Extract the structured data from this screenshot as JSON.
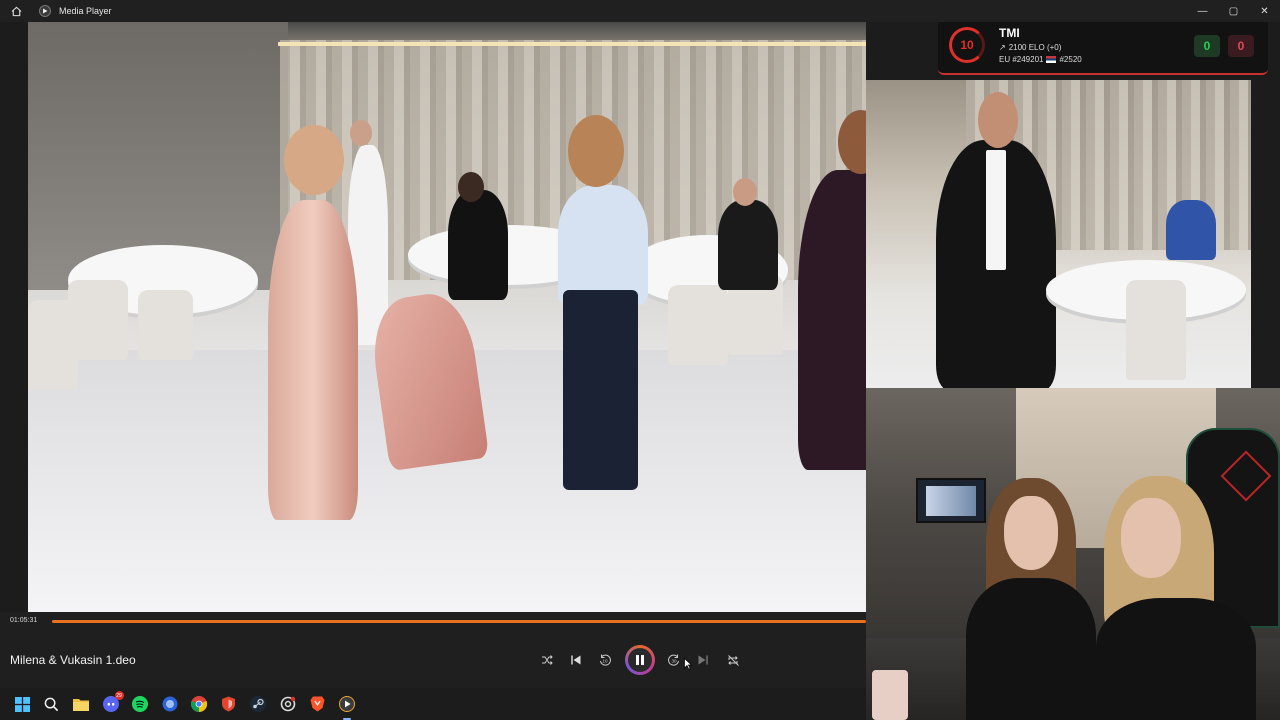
{
  "window": {
    "title": "Media Player",
    "controls": {
      "minimize": "—",
      "maximize": "▢",
      "close": "✕"
    }
  },
  "overlay": {
    "level": "10",
    "player_name": "TMI",
    "elo_line": "2100 ELO (+0)",
    "ranking_region": "EU #249201",
    "ranking_country": "#2520",
    "wins": "0",
    "losses": "0",
    "colors": {
      "accent": "#e0302a",
      "win": "#2ecc57",
      "loss": "#e04a55"
    }
  },
  "player": {
    "elapsed": "01:05:31",
    "progress": 1.0,
    "video_title": "Milena & Vukasin 1.deo",
    "accent": "#e8711f",
    "controls": [
      "shuffle-icon",
      "previous-icon",
      "rewind-10-icon",
      "pause-icon",
      "forward-30-icon",
      "next-icon",
      "repeat-off-icon"
    ],
    "rewind_label": "10",
    "forward_label": "30"
  },
  "taskbar": {
    "items": [
      "windows-start-icon",
      "search-icon",
      "file-explorer-icon",
      "discord-icon",
      "spotify-icon",
      "app-icon",
      "chrome-icon",
      "shield-app-icon",
      "steam-icon",
      "chatgpt-icon",
      "brave-icon",
      "media-player-icon"
    ],
    "discord_badge": "29"
  }
}
